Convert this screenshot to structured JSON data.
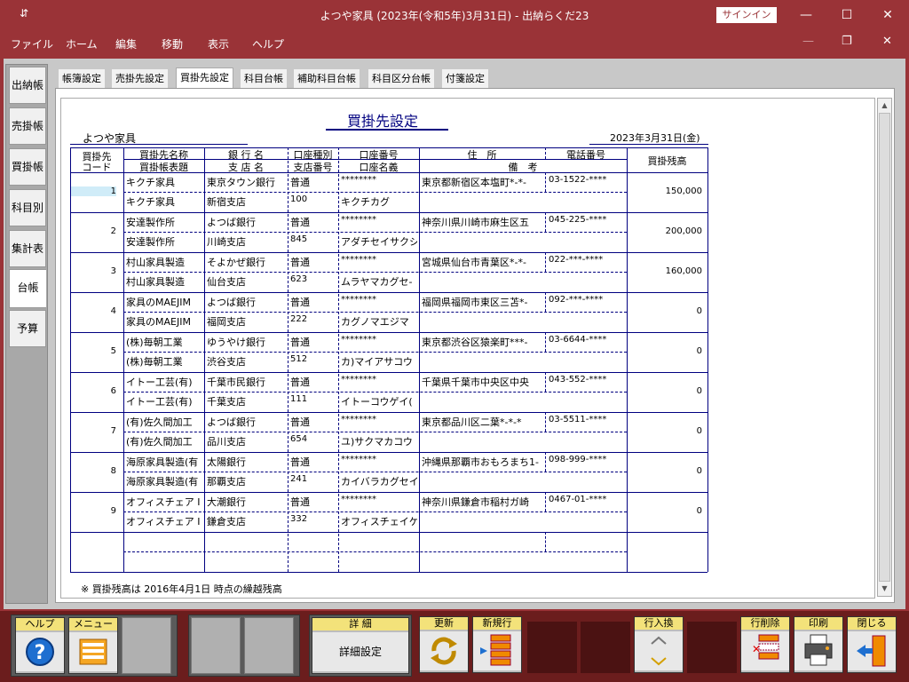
{
  "window": {
    "title": "よつや家具 (2023年(令和5年)3月31日)  -  出納らくだ23",
    "signin": "サインイン",
    "minimize": "—",
    "maximize": "☐",
    "close": "✕",
    "sys_icon": "⇵"
  },
  "menu": {
    "items": [
      "ファイル",
      "ホーム",
      "編集",
      "移動",
      "表示",
      "ヘルプ"
    ],
    "controls": [
      "—",
      "❐",
      "✕"
    ]
  },
  "sidebar": {
    "items": [
      "出納帳",
      "売掛帳",
      "買掛帳",
      "科目別",
      "集計表",
      "台帳",
      "予算"
    ],
    "active_index": 5
  },
  "tabs": {
    "items": [
      "帳簿設定",
      "売掛先設定",
      "買掛先設定",
      "科目台帳",
      "補助科目台帳",
      "科目区分台帳",
      "付箋設定"
    ],
    "active_index": 2
  },
  "report": {
    "title": "買掛先設定",
    "company": "よつや家具",
    "date": "2023年3月31日(金)",
    "headers": {
      "code_1": "買掛先",
      "code_2": "コード",
      "name_1": "買掛先名称",
      "name_2": "買掛帳表題",
      "bank_1": "銀 行 名",
      "bank_2": "支 店 名",
      "acct_1": "口座種別",
      "acct_2": "支店番号",
      "acctno_1": "口座番号",
      "acctno_2": "口座名義",
      "addr_1": "住　所",
      "addr_2": "備　考",
      "tel": "電話番号",
      "balance": "買掛残高"
    },
    "rows": [
      {
        "code": "1",
        "name": "キクチ家具",
        "title": "キクチ家具",
        "bank": "東京タウン銀行",
        "branch": "新宿支店",
        "type": "普通",
        "branch_no": "100",
        "acct_no": "********",
        "holder": "キクチカグ",
        "address": "東京都新宿区本塩町*-*-",
        "tel": "03-1522-****",
        "balance": "150,000"
      },
      {
        "code": "2",
        "name": "安達製作所",
        "title": "安達製作所",
        "bank": "よつば銀行",
        "branch": "川崎支店",
        "type": "普通",
        "branch_no": "845",
        "acct_no": "********",
        "holder": "アダチセイサクシ",
        "address": "神奈川県川崎市麻生区五",
        "tel": "045-225-****",
        "balance": "200,000"
      },
      {
        "code": "3",
        "name": "村山家具製造",
        "title": "村山家具製造",
        "bank": "そよかぜ銀行",
        "branch": "仙台支店",
        "type": "普通",
        "branch_no": "623",
        "acct_no": "********",
        "holder": "ムラヤマカグセ-",
        "address": "宮城県仙台市青葉区*-*-",
        "tel": "022-***-****",
        "balance": "160,000"
      },
      {
        "code": "4",
        "name": "家具のMAEJIM",
        "title": "家具のMAEJIM",
        "bank": "よつば銀行",
        "branch": "福岡支店",
        "type": "普通",
        "branch_no": "222",
        "acct_no": "********",
        "holder": "カグノマエジマ",
        "address": "福岡県福岡市東区三苫*-",
        "tel": "092-***-****",
        "balance": "0"
      },
      {
        "code": "5",
        "name": "(株)毎朝工業",
        "title": "(株)毎朝工業",
        "bank": "ゆうやけ銀行",
        "branch": "渋谷支店",
        "type": "普通",
        "branch_no": "512",
        "acct_no": "********",
        "holder": "カ)マイアサコウ",
        "address": "東京都渋谷区猿楽町***-",
        "tel": "03-6644-****",
        "balance": "0"
      },
      {
        "code": "6",
        "name": "イトー工芸(有)",
        "title": "イトー工芸(有)",
        "bank": "千葉市民銀行",
        "branch": "千葉支店",
        "type": "普通",
        "branch_no": "111",
        "acct_no": "********",
        "holder": "イトーコウゲイ(",
        "address": "千葉県千葉市中央区中央",
        "tel": "043-552-****",
        "balance": "0"
      },
      {
        "code": "7",
        "name": "(有)佐久間加工",
        "title": "(有)佐久間加工",
        "bank": "よつば銀行",
        "branch": "品川支店",
        "type": "普通",
        "branch_no": "654",
        "acct_no": "********",
        "holder": "ユ)サクマカコウ",
        "address": "東京都品川区二葉*-*-*",
        "tel": "03-5511-****",
        "balance": "0"
      },
      {
        "code": "8",
        "name": "海原家具製造(有",
        "title": "海原家具製造(有",
        "bank": "太陽銀行",
        "branch": "那覇支店",
        "type": "普通",
        "branch_no": "241",
        "acct_no": "********",
        "holder": "カイバラカグセイ",
        "address": "沖縄県那覇市おもろまち1-",
        "tel": "098-999-****",
        "balance": "0"
      },
      {
        "code": "9",
        "name": "オフィスチェア I",
        "title": "オフィスチェア I",
        "bank": "大潮銀行",
        "branch": "鎌倉支店",
        "type": "普通",
        "branch_no": "332",
        "acct_no": "********",
        "holder": "オフィスチェイケ",
        "address": "神奈川県鎌倉市稲村ガ崎",
        "tel": "0467-01-****",
        "balance": "0"
      }
    ],
    "footnote": "※ 買掛残高は 2016年4月1日 時点の繰越残高"
  },
  "toolbar": {
    "help": "ヘルプ",
    "menu": "メニュー",
    "detail": "詳 細",
    "detail_btn": "詳細設定",
    "update": "更新",
    "new_row": "新規行",
    "swap": "行入換",
    "delete": "行削除",
    "print": "印刷",
    "close": "閉じる"
  }
}
